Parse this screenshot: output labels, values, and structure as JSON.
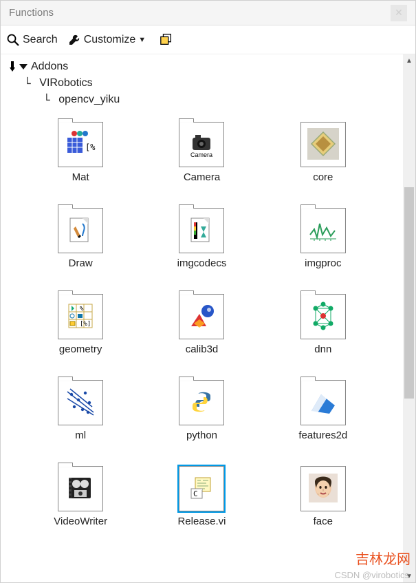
{
  "window": {
    "title": "Functions"
  },
  "toolbar": {
    "search_label": "Search",
    "customize_label": "Customize"
  },
  "tree": {
    "root": "Addons",
    "level1": "VIRobotics",
    "level2": "opencv_yiku"
  },
  "palette": [
    {
      "name": "Mat",
      "icon": "mat"
    },
    {
      "name": "Camera",
      "icon": "camera"
    },
    {
      "name": "core",
      "icon": "core"
    },
    {
      "name": "Draw",
      "icon": "draw"
    },
    {
      "name": "imgcodecs",
      "icon": "imgcodecs"
    },
    {
      "name": "imgproc",
      "icon": "imgproc"
    },
    {
      "name": "geometry",
      "icon": "geometry"
    },
    {
      "name": "calib3d",
      "icon": "calib3d"
    },
    {
      "name": "dnn",
      "icon": "dnn"
    },
    {
      "name": "ml",
      "icon": "ml"
    },
    {
      "name": "python",
      "icon": "python"
    },
    {
      "name": "features2d",
      "icon": "features2d"
    },
    {
      "name": "VideoWriter",
      "icon": "videowriter"
    },
    {
      "name": "Release.vi",
      "icon": "release",
      "selected": true
    },
    {
      "name": "face",
      "icon": "face"
    }
  ],
  "watermarks": {
    "brand": "吉林龙网",
    "credit": "CSDN @virobotics"
  }
}
